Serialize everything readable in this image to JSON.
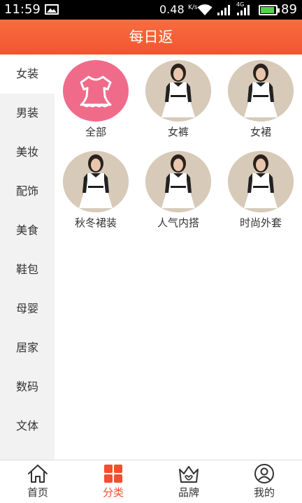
{
  "status_bar": {
    "time": "11:59",
    "speed": "0.48",
    "speed_unit": "K/s",
    "network": "4G",
    "battery": "89"
  },
  "header": {
    "title": "每日返"
  },
  "sidebar": {
    "items": [
      {
        "label": "女装",
        "active": true
      },
      {
        "label": "男装",
        "active": false
      },
      {
        "label": "美妆",
        "active": false
      },
      {
        "label": "配饰",
        "active": false
      },
      {
        "label": "美食",
        "active": false
      },
      {
        "label": "鞋包",
        "active": false
      },
      {
        "label": "母婴",
        "active": false
      },
      {
        "label": "居家",
        "active": false
      },
      {
        "label": "数码",
        "active": false
      },
      {
        "label": "文体",
        "active": false
      }
    ]
  },
  "categories": [
    {
      "label": "全部",
      "icon": "dress-icon"
    },
    {
      "label": "女裤",
      "icon": "model-photo"
    },
    {
      "label": "女裙",
      "icon": "model-photo"
    },
    {
      "label": "秋冬裙装",
      "icon": "model-photo"
    },
    {
      "label": "人气内搭",
      "icon": "model-photo"
    },
    {
      "label": "时尚外套",
      "icon": "model-photo"
    }
  ],
  "bottom_nav": {
    "items": [
      {
        "label": "首页",
        "icon": "home-icon",
        "active": false
      },
      {
        "label": "分类",
        "icon": "grid-icon",
        "active": true
      },
      {
        "label": "品牌",
        "icon": "crown-icon",
        "active": false
      },
      {
        "label": "我的",
        "icon": "user-icon",
        "active": false
      }
    ]
  },
  "colors": {
    "accent": "#f24f2e",
    "header": "#f55a33",
    "sidebar_bg": "#f2f2f2",
    "pink": "#f06b8a"
  }
}
